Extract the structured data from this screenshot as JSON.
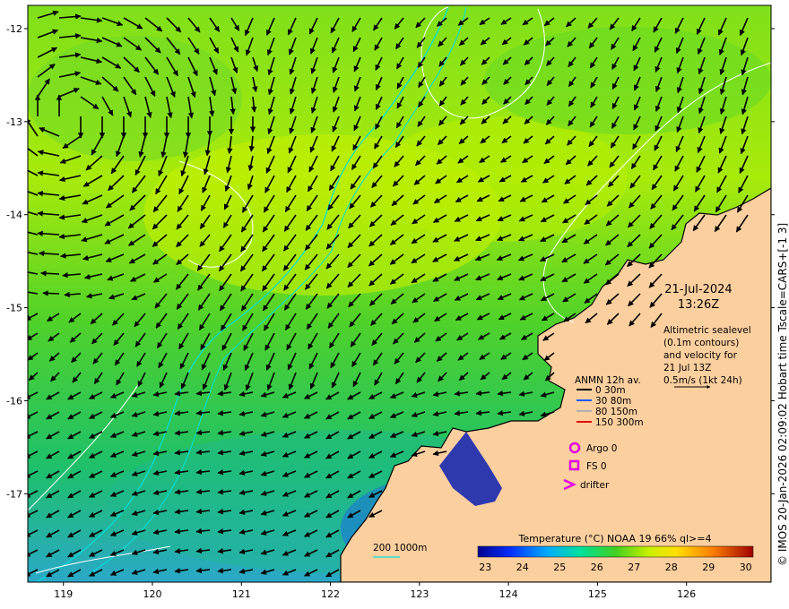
{
  "map": {
    "lon_range": [
      118.6,
      126.95
    ],
    "lat_range": [
      -17.95,
      -11.75
    ],
    "x_ticks": [
      "119",
      "120",
      "121",
      "122",
      "123",
      "124",
      "125",
      "126"
    ],
    "y_ticks": [
      "-12",
      "-13",
      "-14",
      "-15",
      "-16",
      "-17"
    ],
    "colors": {
      "land": "#fccf9e",
      "coast": "#000000",
      "contour_white": "#ffffff",
      "contour_cyan": "#00e0e0",
      "arrow": "#000000"
    }
  },
  "date": {
    "day": "21-Jul-2024",
    "time": "13:26Z"
  },
  "altimetry_note": [
    "Altimetric sealevel",
    "(0.1m contours)",
    "and velocity for",
    "21 Jul 13Z",
    "0.5m/s (1kt 24h)"
  ],
  "anmn_legend": {
    "title": "ANMN 12h av.",
    "items": [
      {
        "label": "0 30m",
        "color": "#000000"
      },
      {
        "label": "30 80m",
        "color": "#1f5cff"
      },
      {
        "label": "80 150m",
        "color": "#b0b0b0"
      },
      {
        "label": "150 300m",
        "color": "#e01010"
      }
    ]
  },
  "markers": [
    {
      "label": "Argo 0",
      "symbol": "circle",
      "color": "#e000e0"
    },
    {
      "label": "FS 0",
      "symbol": "square",
      "color": "#e000e0"
    },
    {
      "label": "drifter",
      "symbol": "chevron",
      "color": "#e000e0"
    }
  ],
  "isobath_label": "200  1000m",
  "colorbar": {
    "title": "Temperature (°C) NOAA 19 66% ql>=4",
    "ticks": [
      "23",
      "24",
      "25",
      "26",
      "27",
      "28",
      "29",
      "30"
    ],
    "range": [
      22.8,
      30.2
    ]
  },
  "credit": "© IMOS 20-Jan-2026 02:09:02 Hobart time Tscale=CARS+[-1 3]"
}
